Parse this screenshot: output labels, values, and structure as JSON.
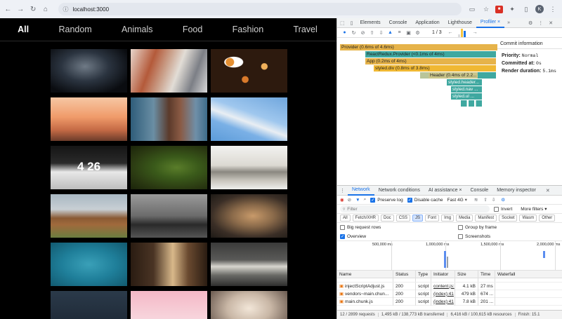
{
  "browser": {
    "url": "localhost:3000",
    "avatar_letter": "K"
  },
  "site": {
    "nav": [
      "All",
      "Random",
      "Animals",
      "Food",
      "Fashion",
      "Travel"
    ],
    "active": "All",
    "photos": [
      "motorcycle-closeup",
      "red-haired-woman",
      "bokeh-lights",
      "balloons-sunset",
      "woman-tree",
      "lighthouse",
      "laptop-clock",
      "mossy-tree",
      "kitchen",
      "mountain",
      "motorbike",
      "man-drinking",
      "swimmer-pool",
      "window-room",
      "tv-room",
      "dark-blue",
      "pink-cake",
      "cupcake"
    ]
  },
  "devtools": {
    "tabs": [
      "Elements",
      "Console",
      "Application",
      "Lighthouse",
      "Profiler ×"
    ],
    "active_tab": "Profiler ×",
    "commit_nav": "1 / 3",
    "commit_info_title": "Commit information",
    "priority_label": "Priority:",
    "priority_value": "Normal",
    "committed_label": "Committed at:",
    "committed_value": "0s",
    "render_label": "Render duration:",
    "render_value": "5.1ms",
    "flame": [
      "Provider (0.6ms of 4.6ms)",
      "ReactRedux.Provider (<0.1ms of 4ms)",
      "App (0.2ms of 4ms)",
      "styled.div (0.8ms of 3.8ms)",
      "Header (0.4ms of 2.2...",
      "styled.header...",
      "styled.nav ...",
      "styled.ul ..."
    ]
  },
  "drawer": {
    "tabs": [
      "Network",
      "Network conditions",
      "AI assistance ×",
      "Console",
      "Memory inspector"
    ],
    "active_tab": "Network",
    "preserve_log": "Preserve log",
    "disable_cache": "Disable cache",
    "throttle": "Fast 4G",
    "filter_placeholder": "Filter",
    "invert": "Invert",
    "more_filters": "More filters ▾",
    "types": [
      "All",
      "Fetch/XHR",
      "Doc",
      "CSS",
      "JS",
      "Font",
      "Img",
      "Media",
      "Manifest",
      "Socket",
      "Wasm",
      "Other"
    ],
    "active_type": "JS",
    "big_rows": "Big request rows",
    "group_frame": "Group by frame",
    "overview": "Overview",
    "screenshots": "Screenshots",
    "timeline_ticks": [
      "500,000 ms",
      "1,000,000 ms",
      "1,500,000 ms",
      "2,000,000 ms"
    ],
    "columns": [
      "Name",
      "Status",
      "Type",
      "Initiator",
      "Size",
      "Time",
      "Waterfall"
    ],
    "rows": [
      {
        "name": "injectScriptAdjust.js",
        "status": "200",
        "type": "script",
        "initiator": "content.js:",
        "size": "4.1 kB",
        "time": "27 ms"
      },
      {
        "name": "vendors~main.chun...",
        "status": "200",
        "type": "script",
        "initiator": "(index):41",
        "size": "479 kB",
        "time": "674 ..."
      },
      {
        "name": "main.chunk.js",
        "status": "200",
        "type": "script",
        "initiator": "(index):41",
        "size": "7.8 kB",
        "time": "201 ..."
      }
    ],
    "status": [
      "12 / 2899 requests",
      "1,495 kB / 138,773 kB transferred",
      "6,416 kB / 100,615 kB resources",
      "Finish: 15.1"
    ]
  }
}
